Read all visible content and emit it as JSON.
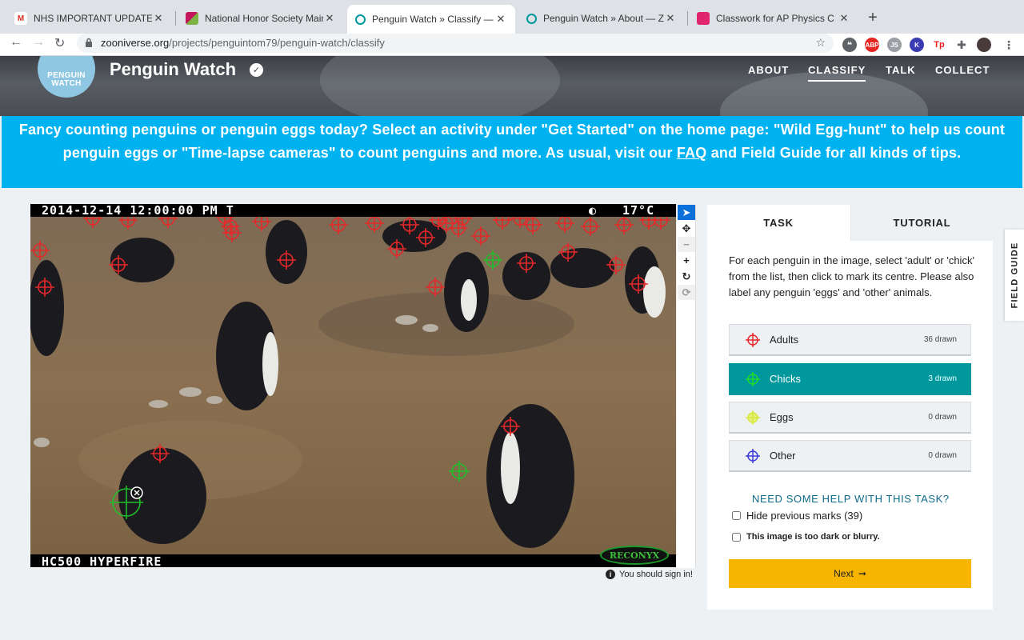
{
  "browser": {
    "tabs": [
      {
        "title": "NHS IMPORTANT UPDATES - i",
        "favicon": "gmail-icon"
      },
      {
        "title": "National Honor Society Maine I",
        "favicon": "nhs-icon"
      },
      {
        "title": "Penguin Watch » Classify — Zo",
        "favicon": "zooniverse-icon",
        "active": true
      },
      {
        "title": "Penguin Watch » About — Zoo",
        "favicon": "zooniverse-icon"
      },
      {
        "title": "Classwork for AP Physics C Pe",
        "favicon": "classroom-icon"
      }
    ],
    "url_host": "zooniverse.org",
    "url_path": "/projects/penguintom79/penguin-watch/classify",
    "extensions": {
      "abp": "ABP",
      "js": "JS",
      "k": "K",
      "tp": "Tp"
    }
  },
  "site": {
    "logo_line1": "PENGUIN",
    "logo_line2": "WATCH",
    "project_title": "Penguin Watch",
    "nav": {
      "about": "ABOUT",
      "classify": "CLASSIFY",
      "talk": "TALK",
      "collect": "COLLECT"
    }
  },
  "announcement": {
    "part1": "Fancy counting penguins or penguin eggs today? Select an activity under \"Get Started\" on the home page: \"Wild Egg-hunt\" to help us count penguin eggs or \"Time-lapse cameras\" to count penguins and more. As usual, visit our ",
    "link": "FAQ",
    "part2": " and Field Guide for all kinds of tips."
  },
  "subject": {
    "timestamp": "2014-12-14  12:00:00 PM   T",
    "temperature": "17°C",
    "camera_model": "HC500 HYPERFIRE",
    "brand": "RECONYX",
    "sign_in_note": "You should sign in!"
  },
  "task_panel": {
    "tabs": {
      "task": "TASK",
      "tutorial": "TUTORIAL"
    },
    "instructions": "For each penguin in the image, select 'adult' or 'chick' from the list, then click to mark its centre. Please also label any penguin 'eggs' and 'other' animals.",
    "tools": [
      {
        "label": "Adults",
        "count": "36 drawn",
        "color": "#e5282a"
      },
      {
        "label": "Chicks",
        "count": "3 drawn",
        "color": "#1fbf2a",
        "selected": true
      },
      {
        "label": "Eggs",
        "count": "0 drawn",
        "color": "#d6e83a"
      },
      {
        "label": "Other",
        "count": "0 drawn",
        "color": "#3b3bd9"
      }
    ],
    "help_link": "NEED SOME HELP WITH THIS TASK?",
    "hide_marks": "Hide previous marks (39)",
    "too_dark": "This image is too dark or blurry.",
    "next": "Next"
  },
  "field_guide": "FIELD GUIDE"
}
